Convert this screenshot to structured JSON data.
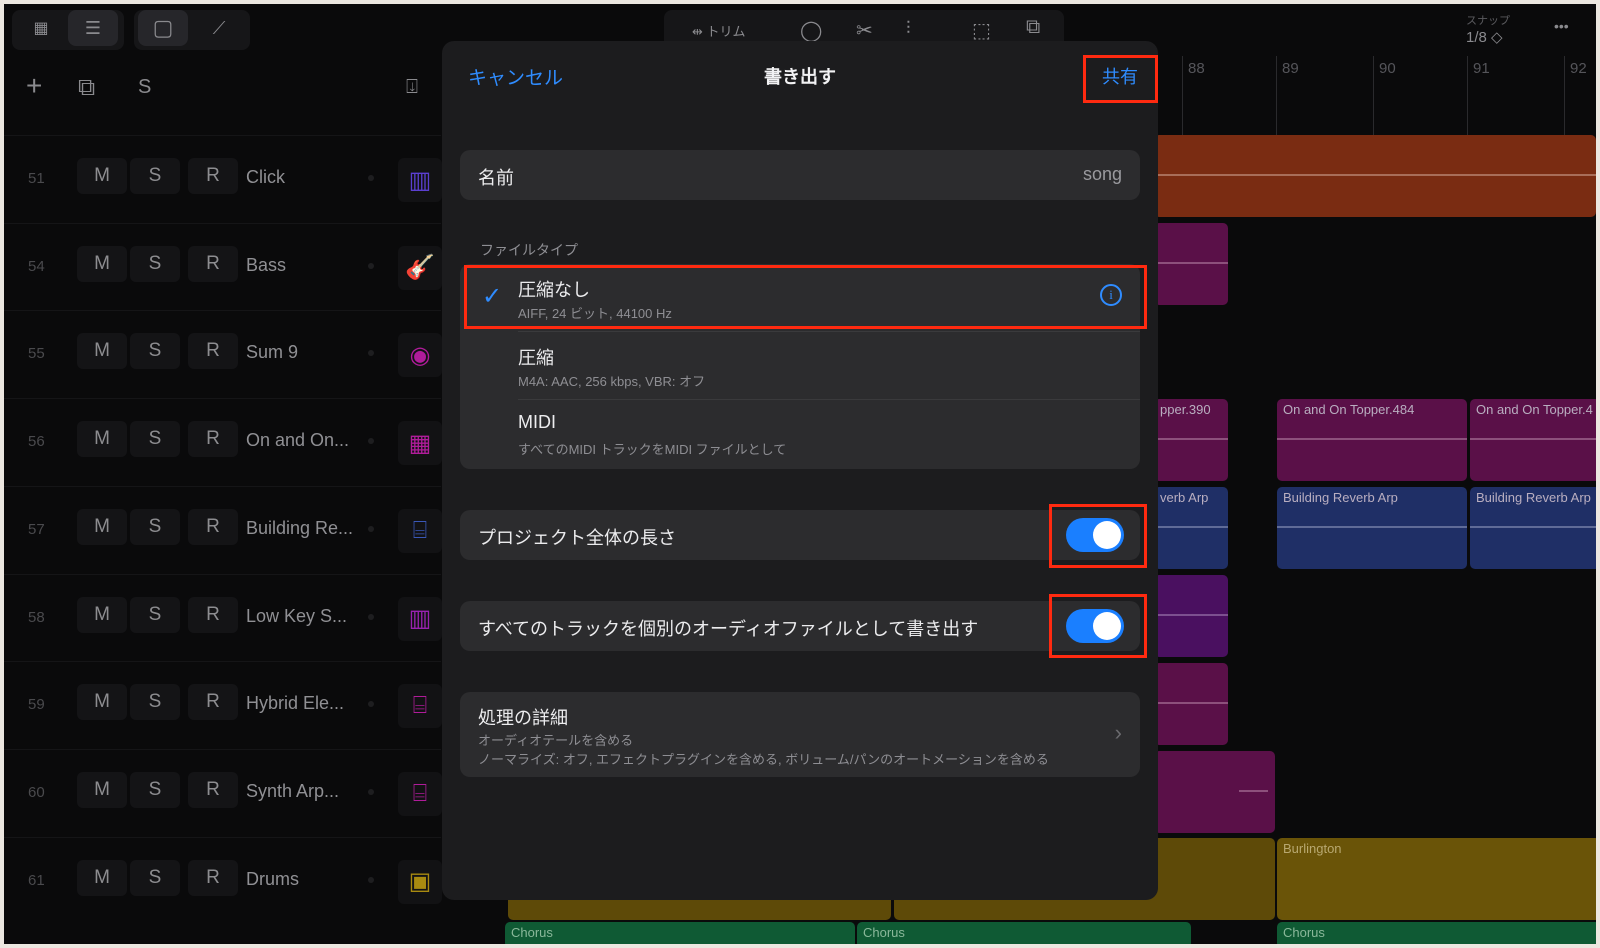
{
  "toolbar": {
    "trim_label": "トリム",
    "snap_label": "スナップ",
    "snap_value": "1/8 ◇",
    "more": "•••",
    "solo_header": "S"
  },
  "ruler": [
    "88",
    "89",
    "90",
    "91",
    "92"
  ],
  "tracks": [
    {
      "number": "51",
      "mute": "M",
      "solo": "S",
      "record": "R",
      "name": "Click",
      "icon": "keyboard-icon",
      "color": "#5b3fd0"
    },
    {
      "number": "54",
      "mute": "M",
      "solo": "S",
      "record": "R",
      "name": "Bass",
      "icon": "bass-guitar-icon",
      "color": "#b01c9a"
    },
    {
      "number": "55",
      "mute": "M",
      "solo": "S",
      "record": "R",
      "name": "Sum 9",
      "icon": "knob-icon",
      "color": "#b01c9a"
    },
    {
      "number": "56",
      "mute": "M",
      "solo": "S",
      "record": "R",
      "name": "On and On...",
      "icon": "grid-keyboard-icon",
      "color": "#b01c9a"
    },
    {
      "number": "57",
      "mute": "M",
      "solo": "S",
      "record": "R",
      "name": "Building Re...",
      "icon": "keyboard-stand-icon",
      "color": "#3a58b8"
    },
    {
      "number": "58",
      "mute": "M",
      "solo": "S",
      "record": "R",
      "name": "Low Key S...",
      "icon": "synth-icon",
      "color": "#9a22b0"
    },
    {
      "number": "59",
      "mute": "M",
      "solo": "S",
      "record": "R",
      "name": "Hybrid Ele...",
      "icon": "keyboard-stand-icon",
      "color": "#b01c9a"
    },
    {
      "number": "60",
      "mute": "M",
      "solo": "S",
      "record": "R",
      "name": "Synth Arp...",
      "icon": "keyboard-stand-icon",
      "color": "#b01c9a"
    },
    {
      "number": "61",
      "mute": "M",
      "solo": "S",
      "record": "R",
      "name": "Drums",
      "icon": "drum-machine-icon",
      "color": "#a88a10"
    }
  ],
  "regions": {
    "topper_390": "pper.390",
    "topper_484": "On and On Topper.484",
    "topper_next": "On and On Topper.4",
    "reverb_partial": "verb Arp",
    "reverb_1": "Building Reverb Arp",
    "reverb_2": "Building Reverb Arp",
    "burlington": "Burlington",
    "chorus": [
      "Chorus",
      "Chorus",
      "Chorus"
    ]
  },
  "dialog": {
    "cancel": "キャンセル",
    "title": "書き出す",
    "share": "共有",
    "name_label": "名前",
    "name_value": "song",
    "file_type_header": "ファイルタイプ",
    "file_types": [
      {
        "title": "圧縮なし",
        "detail": "AIFF, 24 ビット, 44100 Hz",
        "selected": true
      },
      {
        "title": "圧縮",
        "detail": "M4A: AAC, 256 kbps, VBR: オフ",
        "selected": false
      },
      {
        "title": "MIDI",
        "detail": "すべてのMIDI トラックをMIDI ファイルとして",
        "selected": false
      }
    ],
    "full_length_label": "プロジェクト全体の長さ",
    "full_length_on": true,
    "separate_tracks_label": "すべてのトラックを個別のオーディオファイルとして書き出す",
    "separate_tracks_on": true,
    "processing_title": "処理の詳細",
    "processing_line1": "オーディオテールを含める",
    "processing_line2": "ノーマライズ: オフ, エフェクトプラグインを含める, ボリューム/パンのオートメーションを含める"
  },
  "colors": {
    "accent": "#2f8cff",
    "highlight": "#ff2a10"
  }
}
